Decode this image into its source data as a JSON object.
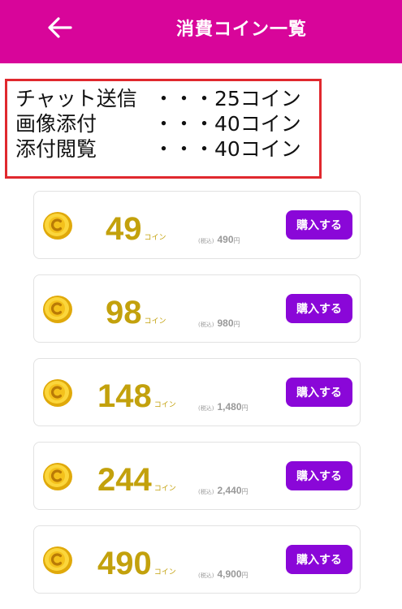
{
  "header": {
    "title": "消費コイン一覧",
    "back_icon": "arrow-left-icon"
  },
  "colors": {
    "header_bg": "#d8059a",
    "buy_button_bg": "#8a07d8",
    "amount_text": "#c3a10c",
    "info_border": "#e0282e"
  },
  "consumption": [
    {
      "name": "チャット送信",
      "cost": "・・・25コイン"
    },
    {
      "name": "画像添付",
      "cost": "・・・40コイン"
    },
    {
      "name": "添付閲覧",
      "cost": "・・・40コイン"
    }
  ],
  "packs": [
    {
      "amount": "49",
      "unit": "コイン",
      "tax_label": "(税込)",
      "price": "490",
      "yen": "円",
      "button": "購入する"
    },
    {
      "amount": "98",
      "unit": "コイン",
      "tax_label": "(税込)",
      "price": "980",
      "yen": "円",
      "button": "購入する"
    },
    {
      "amount": "148",
      "unit": "コイン",
      "tax_label": "(税込)",
      "price": "1,480",
      "yen": "円",
      "button": "購入する"
    },
    {
      "amount": "244",
      "unit": "コイン",
      "tax_label": "(税込)",
      "price": "2,440",
      "yen": "円",
      "button": "購入する"
    },
    {
      "amount": "490",
      "unit": "コイン",
      "tax_label": "(税込)",
      "price": "4,900",
      "yen": "円",
      "button": "購入する"
    }
  ]
}
